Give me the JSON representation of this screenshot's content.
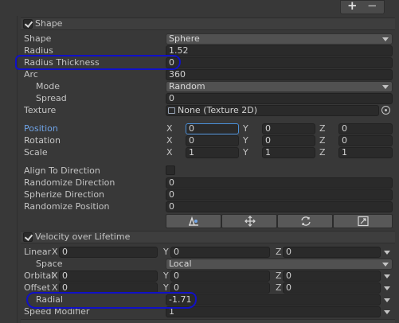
{
  "toolbar": {
    "add_label": "+",
    "remove_label": "−"
  },
  "shape_module": {
    "title": "Shape",
    "enabled": true,
    "shape": {
      "label": "Shape",
      "value": "Sphere"
    },
    "radius": {
      "label": "Radius",
      "value": "1.52"
    },
    "radius_thickness": {
      "label": "Radius Thickness",
      "value": "0"
    },
    "arc": {
      "label": "Arc",
      "value": "360"
    },
    "mode": {
      "label": "Mode",
      "value": "Random"
    },
    "spread": {
      "label": "Spread",
      "value": "0"
    },
    "texture": {
      "label": "Texture",
      "value": "None (Texture 2D)"
    },
    "position": {
      "label": "Position",
      "x": "0",
      "y": "0",
      "z": "0"
    },
    "rotation": {
      "label": "Rotation",
      "x": "0",
      "y": "0",
      "z": "0"
    },
    "scale": {
      "label": "Scale",
      "x": "1",
      "y": "1",
      "z": "1"
    },
    "axis_labels": {
      "x": "X",
      "y": "Y",
      "z": "Z"
    },
    "align_to_direction": {
      "label": "Align To Direction",
      "checked": false
    },
    "randomize_direction": {
      "label": "Randomize Direction",
      "value": "0"
    },
    "spherize_direction": {
      "label": "Spherize Direction",
      "value": "0"
    },
    "randomize_position": {
      "label": "Randomize Position",
      "value": "0"
    },
    "tool_icons": [
      "edit-shape-icon",
      "move-icon",
      "rotate-icon",
      "scale-icon"
    ]
  },
  "velocity_module": {
    "title": "Velocity over Lifetime",
    "enabled": true,
    "linear": {
      "label": "Linear",
      "x": "0",
      "y": "0",
      "z": "0"
    },
    "space": {
      "label": "Space",
      "value": "Local"
    },
    "orbital": {
      "label": "Orbital",
      "x": "0",
      "y": "0",
      "z": "0"
    },
    "offset": {
      "label": "Offset",
      "x": "0",
      "y": "0",
      "z": "0"
    },
    "radial": {
      "label": "Radial",
      "value": "-1.71"
    },
    "speed_modifier": {
      "label": "Speed Modifier",
      "value": "1"
    }
  },
  "colors": {
    "background": "#383838",
    "field": "#2a2a2a",
    "highlight_label": "#6fa3e6",
    "active_field_border": "#4a8fd8",
    "annotation": "#1010c8"
  }
}
